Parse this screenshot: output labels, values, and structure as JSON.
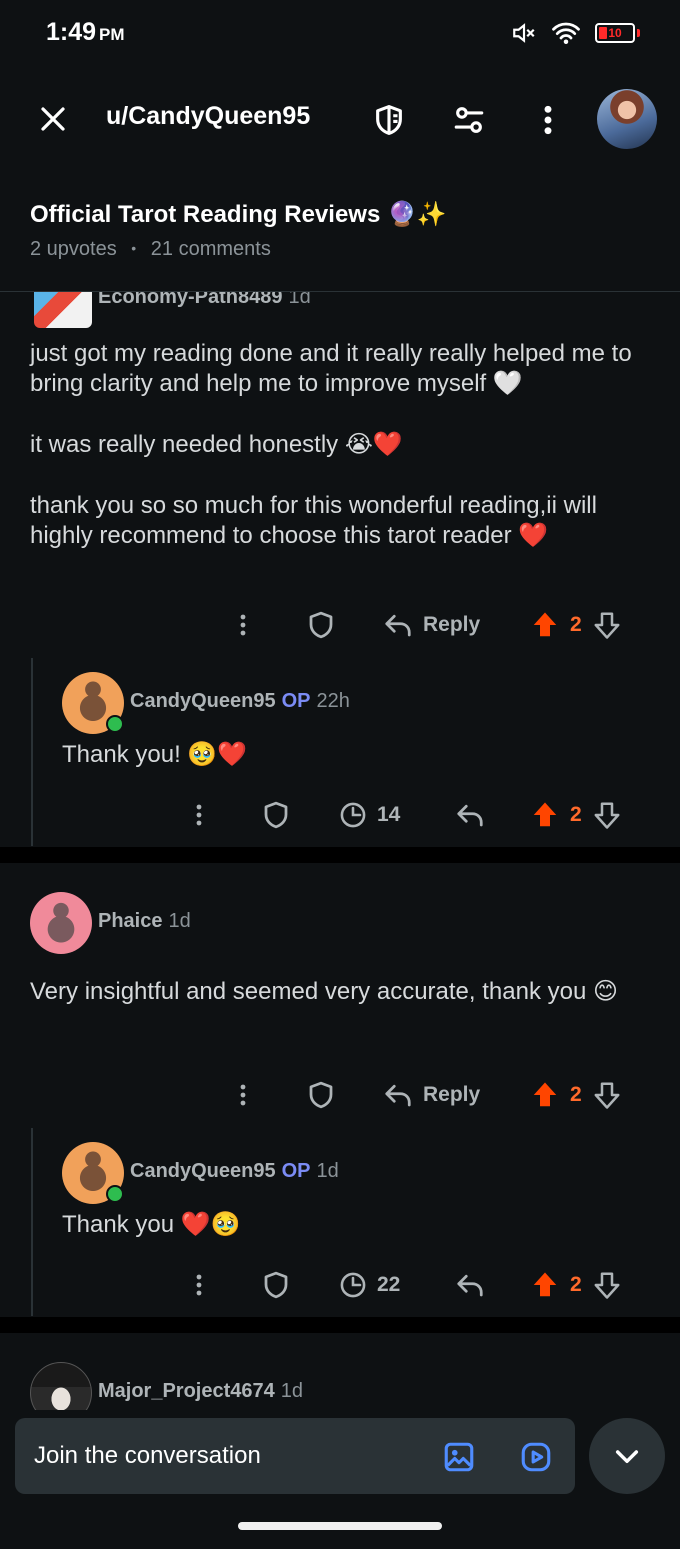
{
  "status_bar": {
    "time": "1:49",
    "ampm": "PM",
    "battery": "10"
  },
  "header": {
    "title": "u/CandyQueen95"
  },
  "post": {
    "title": "Official Tarot Reading Reviews 🔮✨",
    "upvotes": "2 upvotes",
    "comments": "21 comments",
    "meta_separator": "•"
  },
  "comments": [
    {
      "author": "Economy-Path8489",
      "age": "1d",
      "body": [
        "just got my reading done and it really really helped me to bring clarity and help me to improve myself 🤍",
        "it was really needed honestly 😭❤️",
        "thank you so so much for this wonderful reading,ii will highly recommend to choose this tarot reader ❤️"
      ],
      "reply_label": "Reply",
      "votes": "2",
      "reply": {
        "author": "CandyQueen95",
        "op": "OP",
        "age": "22h",
        "body": "Thank you! 🥹❤️",
        "views": "14",
        "votes": "2"
      }
    },
    {
      "author": "Phaice",
      "age": "1d",
      "body": [
        "Very insightful and seemed very accurate, thank you 😊"
      ],
      "reply_label": "Reply",
      "votes": "2",
      "reply": {
        "author": "CandyQueen95",
        "op": "OP",
        "age": "1d",
        "body": "Thank you ❤️🥹",
        "views": "22",
        "votes": "2"
      }
    },
    {
      "author": "Major_Project4674",
      "age": "1d"
    }
  ],
  "composer": {
    "placeholder": "Join the conversation"
  },
  "colors": {
    "background": "#0e1113",
    "upvote": "#ff4500",
    "op": "#7b8cf5",
    "accent_icon": "#4f8cff"
  },
  "icons": [
    "close-icon",
    "shield-icon",
    "filter-icon",
    "more-icon",
    "image-icon",
    "video-icon",
    "chevron-down-icon",
    "upvote-icon",
    "downvote-icon",
    "reply-icon",
    "views-icon"
  ]
}
